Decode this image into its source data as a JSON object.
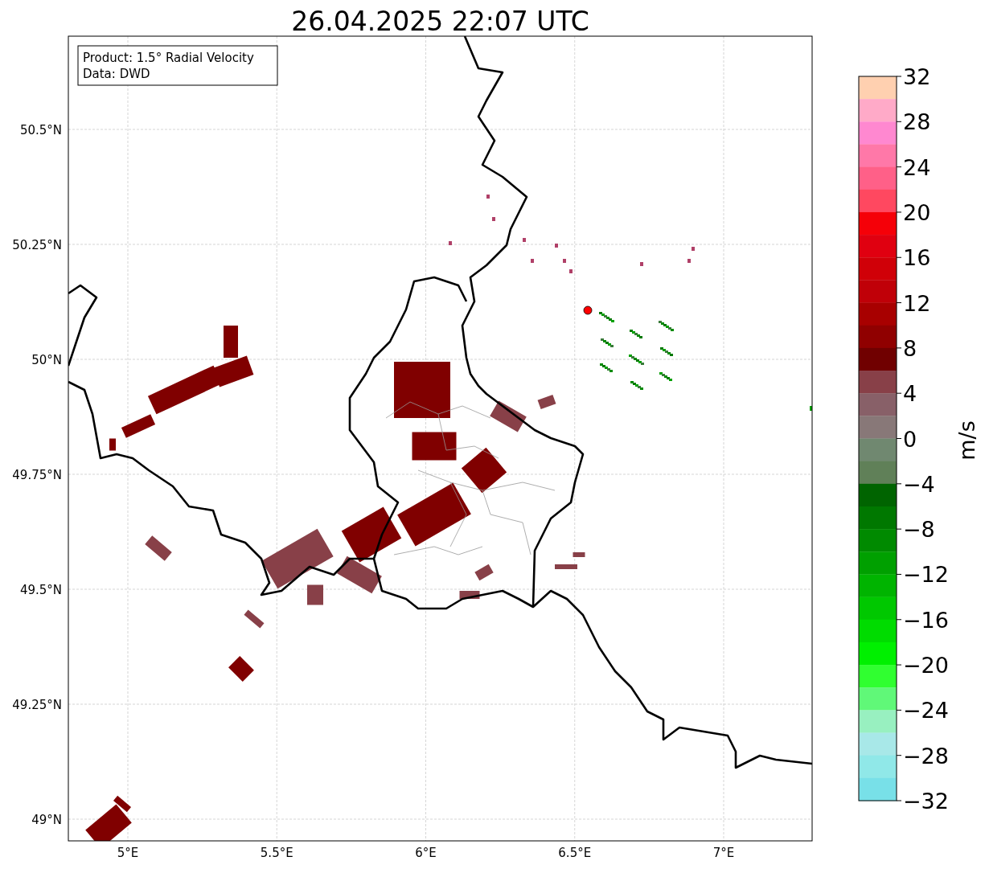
{
  "title": "26.04.2025 22:07 UTC",
  "info_box": {
    "lines": [
      "Product: 1.5° Radial Velocity",
      "Data: DWD"
    ]
  },
  "map": {
    "lat_labels": [
      "50.5°N",
      "50.25°N",
      "50°N",
      "49.75°N",
      "49.5°N",
      "49.25°N",
      "49°N"
    ],
    "lon_labels": [
      "5°E",
      "5.5°E",
      "6°E",
      "6.5°E",
      "7°E"
    ]
  },
  "colorbar": {
    "label": "m/s",
    "ticks": [
      "32",
      "28",
      "24",
      "20",
      "16",
      "12",
      "8",
      "4",
      "0",
      "−4",
      "−8",
      "−12",
      "−16",
      "−20",
      "−24",
      "−28",
      "−32"
    ],
    "segments": [
      {
        "color": "#ffd0b0"
      },
      {
        "color": "#ffaac8"
      },
      {
        "color": "#ff88d0"
      },
      {
        "color": "#ff78a8"
      },
      {
        "color": "#ff6088"
      },
      {
        "color": "#ff4860"
      },
      {
        "color": "#f50008"
      },
      {
        "color": "#e00010"
      },
      {
        "color": "#d00008"
      },
      {
        "color": "#c00008"
      },
      {
        "color": "#a80000"
      },
      {
        "color": "#900000"
      },
      {
        "color": "#700000"
      },
      {
        "color": "#884048"
      },
      {
        "color": "#886068"
      },
      {
        "color": "#887878"
      },
      {
        "color": "#708870"
      },
      {
        "color": "#608058"
      },
      {
        "color": "#006400"
      },
      {
        "color": "#007800"
      },
      {
        "color": "#008a00"
      },
      {
        "color": "#00a000"
      },
      {
        "color": "#00b400"
      },
      {
        "color": "#00c800"
      },
      {
        "color": "#00dc00"
      },
      {
        "color": "#00f000"
      },
      {
        "color": "#30ff30"
      },
      {
        "color": "#60f878"
      },
      {
        "color": "#98f0c0"
      },
      {
        "color": "#a8e8e8"
      },
      {
        "color": "#90e8e8"
      },
      {
        "color": "#78e0e8"
      }
    ]
  }
}
